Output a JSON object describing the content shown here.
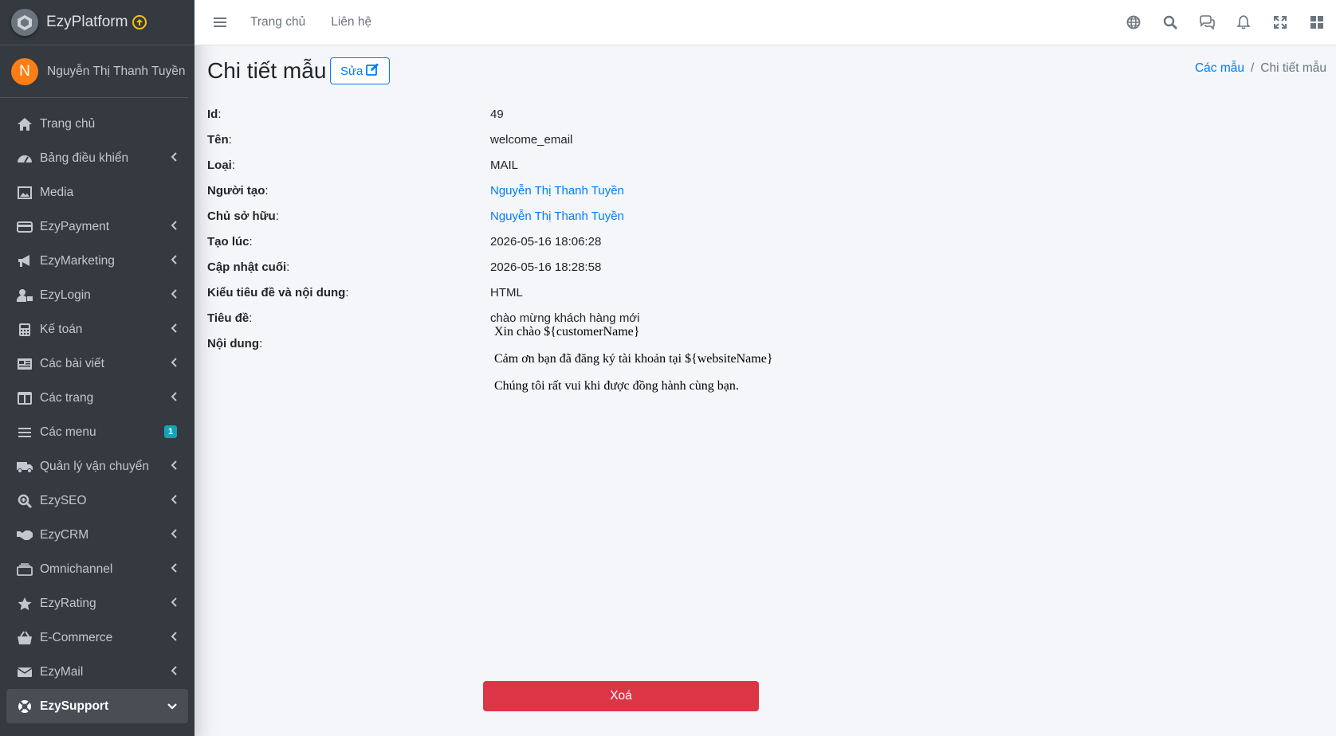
{
  "brand": {
    "name": "EzyPlatform",
    "logo_icon": "platform-logo-icon"
  },
  "user": {
    "initial": "N",
    "name": "Nguyễn Thị Thanh Tuyền",
    "avatar_color": "#fd7e14"
  },
  "sidebar": {
    "items": [
      {
        "label": "Trang chủ",
        "icon": "home-icon"
      },
      {
        "label": "Bảng điều khiển",
        "icon": "dashboard-icon"
      },
      {
        "label": "Media",
        "icon": "image-icon"
      },
      {
        "label": "EzyPayment",
        "icon": "credit-card-icon"
      },
      {
        "label": "EzyMarketing",
        "icon": "megaphone-icon"
      },
      {
        "label": "EzyLogin",
        "icon": "user-lock-icon"
      },
      {
        "label": "Kế toán",
        "icon": "calculator-icon"
      },
      {
        "label": "Các bài viết",
        "icon": "newspaper-icon"
      },
      {
        "label": "Các trang",
        "icon": "columns-icon"
      },
      {
        "label": "Các menu",
        "icon": "bars-icon",
        "badge": "1"
      },
      {
        "label": "Quản lý vận chuyển",
        "icon": "truck-icon"
      },
      {
        "label": "EzySEO",
        "icon": "search-plus-icon"
      },
      {
        "label": "EzyCRM",
        "icon": "handshake-icon"
      },
      {
        "label": "Omnichannel",
        "icon": "layers-icon"
      },
      {
        "label": "EzyRating",
        "icon": "star-icon"
      },
      {
        "label": "E-Commerce",
        "icon": "basket-icon"
      },
      {
        "label": "EzyMail",
        "icon": "envelope-icon"
      },
      {
        "label": "EzySupport",
        "icon": "lifering-icon"
      }
    ]
  },
  "header": {
    "links": [
      "Trang chủ",
      "Liên hệ"
    ],
    "icons": [
      "globe-icon",
      "search-icon",
      "chat-icon",
      "bell-icon",
      "expand-icon",
      "apps-icon"
    ]
  },
  "page": {
    "title": "Chi tiết mẫu",
    "edit_label": "Sửa",
    "breadcrumb": {
      "parent": "Các mẫu",
      "separator": "/",
      "current": "Chi tiết mẫu"
    }
  },
  "details": {
    "id_label": "Id",
    "id_value": "49",
    "name_label": "Tên",
    "name_value": "welcome_email",
    "type_label": "Loại",
    "type_value": "MAIL",
    "creator_label": "Người tạo",
    "creator_value": "Nguyễn Thị Thanh Tuyền",
    "owner_label": "Chủ sở hữu",
    "owner_value": "Nguyễn Thị Thanh Tuyền",
    "created_label": "Tạo lúc",
    "created_value": "2026-05-16 18:06:28",
    "updated_label": "Cập nhật cuối",
    "updated_value": "2026-05-16 18:28:58",
    "format_label": "Kiểu tiêu đề và nội dung",
    "format_value": "HTML",
    "subject_label": "Tiêu đề",
    "subject_value": "chào mừng khách hàng mới",
    "content_label": "Nội dung",
    "content_lines": [
      "Xin chào ${customerName}",
      "Cảm ơn bạn đã đăng ký tài khoản tại ${websiteName}",
      "Chúng tôi rất vui khi được đồng hành cùng bạn."
    ]
  },
  "actions": {
    "delete_label": "Xoá"
  },
  "colors": {
    "sidebar_bg": "#343a40",
    "primary": "#007bff",
    "danger": "#dc3545",
    "badge": "#17a2b8"
  }
}
